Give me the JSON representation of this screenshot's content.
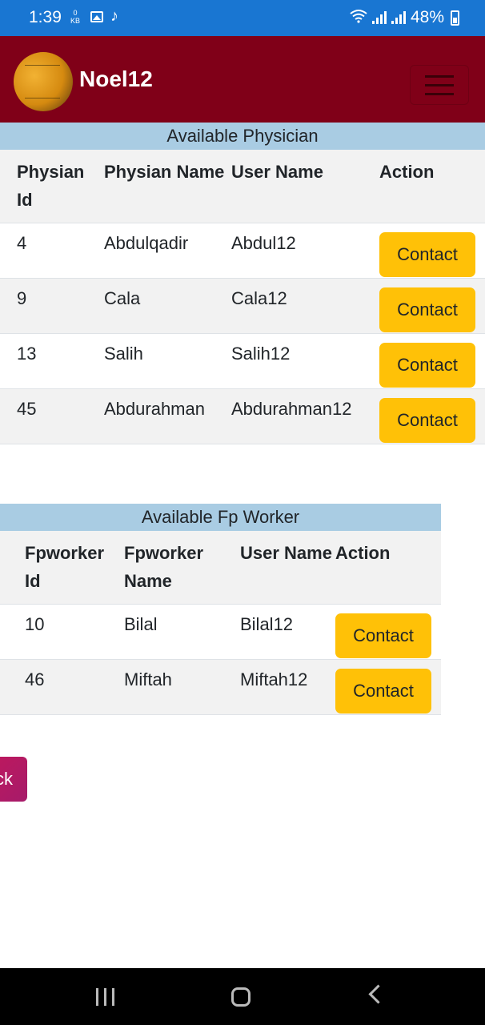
{
  "status_bar": {
    "time": "1:39",
    "kb_value": "0",
    "kb_unit": "KB",
    "battery": "48%",
    "icons": [
      "gallery-icon",
      "tiktok-icon",
      "wifi-icon",
      "signal-icon",
      "battery-icon"
    ]
  },
  "navbar": {
    "brand": "Noel12",
    "menu_icon": "hamburger-menu-icon",
    "background": "#800018"
  },
  "physicians": {
    "caption": "Available Physician",
    "headers": [
      "Physian Id",
      "Physian Name",
      "User Name",
      "Action"
    ],
    "rows": [
      {
        "id": "4",
        "name": "Abdulqadir",
        "username": "Abdul12",
        "action": "Contact"
      },
      {
        "id": "9",
        "name": "Cala",
        "username": "Cala12",
        "action": "Contact"
      },
      {
        "id": "13",
        "name": "Salih",
        "username": "Salih12",
        "action": "Contact"
      },
      {
        "id": "45",
        "name": "Abdurahman",
        "username": "Abdurahman12",
        "action": "Contact"
      }
    ]
  },
  "fpworkers": {
    "caption": "Available Fp Worker",
    "headers": [
      "Fpworker Id",
      "Fpworker Name",
      "User Name",
      "Action"
    ],
    "rows": [
      {
        "id": "10",
        "name": "Bilal",
        "username": "Bilal12",
        "action": "Contact"
      },
      {
        "id": "46",
        "name": "Miftah",
        "username": "Miftah12",
        "action": "Contact"
      }
    ]
  },
  "back_button": {
    "label": "ck"
  },
  "colors": {
    "status_bar": "#1976d2",
    "caption": "#a9cce3",
    "contact_button": "#ffc107",
    "back_button": "#c2185b"
  },
  "android_nav": {
    "icons": [
      "recents-icon",
      "home-icon",
      "back-arrow-icon"
    ]
  }
}
